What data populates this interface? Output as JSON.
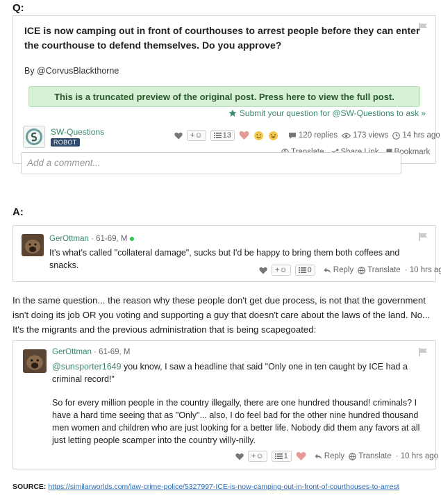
{
  "labels": {
    "q": "Q:",
    "a": "A:"
  },
  "question": {
    "title": "ICE is now camping out in front of courthouses to arrest people before they can enter the courthouse to defend themselves. Do you approve?",
    "by": "By @CorvusBlackthorne",
    "preview_notice": "This is a truncated preview of the original post. Press here to view the full post.",
    "submit_link": "Submit your question for @SW-Questions to ask »",
    "author": "SW-Questions",
    "author_badge": "ROBOT",
    "reaction_add": "+☺",
    "list_count": "13",
    "replies": "120 replies",
    "views": "173 views",
    "time": "14 hrs ago",
    "translate": "Translate",
    "share": "Share Link",
    "bookmark": "Bookmark",
    "comment_placeholder": "Add a comment..."
  },
  "reply1": {
    "author": "GerOttman",
    "age": " · 61-69, M",
    "text": "It's what's called \"collateral damage\", sucks but I'd be happy to bring them both coffees and snacks.",
    "reaction_add": "+☺",
    "list_count": "0",
    "reply": "Reply",
    "translate": "Translate",
    "time": "· 10 hrs ago"
  },
  "middle_text": "In the same question... the reason why these people don't get due process, is not that the government isn't doing its job OR you voting and supporting a guy that doesn't care about the laws of the land. No... It's the migrants and the previous administration that is being scapegoated:",
  "reply2": {
    "author": "GerOttman",
    "age": " · 61-69, M",
    "mention": "@sunsporter1649",
    "text1": " you know, I saw a headline that said \"Only one in ten caught by ICE had a criminal record!\"",
    "text2": "So for every million people in the country illegally, there are one hundred thousand! criminals? I have a hard time seeing that as \"Only\"... also, I do feel bad for the other nine hundred thousand men women and children who are just looking for a better life. Nobody did them any favors at all just letting people scamper into the country willy-nilly.",
    "reaction_add": "+☺",
    "list_count": "1",
    "reply": "Reply",
    "translate": "Translate",
    "time": "· 10 hrs ago"
  },
  "source": {
    "label": "SOURCE:",
    "url": "https://similarworlds.com/law-crime-police/5327997-ICE-is-now-camping-out-in-front-of-courthouses-to-arrest"
  },
  "icons": {
    "flag": "flag-icon",
    "heart": "heart-icon",
    "list": "list-icon",
    "replies": "speech-bubble-icon",
    "views": "eye-icon",
    "time": "clock-icon",
    "translate": "globe-icon",
    "share": "share-icon",
    "bookmark": "bookmark-icon",
    "reply": "reply-arrow-icon",
    "star": "star-icon"
  },
  "colors": {
    "accent": "#3a8a6a",
    "preview_bg": "#d6f0d6",
    "badge": "#2f4a6a",
    "link": "#2a6ab0"
  }
}
